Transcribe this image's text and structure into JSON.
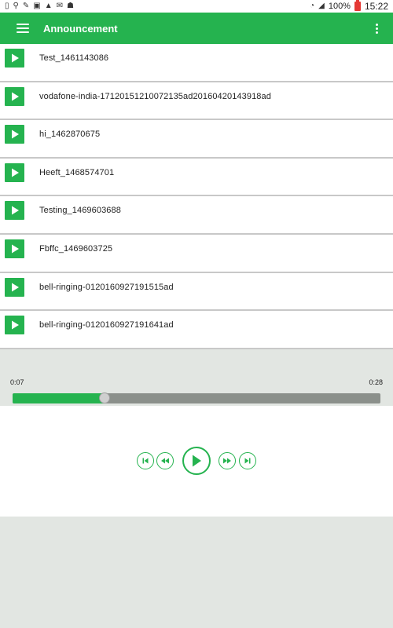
{
  "status_bar": {
    "battery": "100%",
    "time": "15:22"
  },
  "app_bar": {
    "title": "Announcement"
  },
  "tracks": [
    "Test_1461143086",
    "vodafone-india-17120151210072135ad20160420143918ad",
    "hi_1462870675",
    "Heeft_1468574701",
    "Testing_1469603688",
    "Fbffc_1469603725",
    "bell-ringing-0120160927191515ad",
    "bell-ringing-0120160927191641ad"
  ],
  "player": {
    "current_time": "0:07",
    "total_time": "0:28",
    "progress": 0.25
  },
  "colors": {
    "accent": "#25b34f",
    "progress_track": "#8b908b",
    "background": "#e2e6e2"
  },
  "icons": {
    "prev": "skip-previous-icon",
    "rewind": "rewind-icon",
    "play": "play-icon",
    "forward": "fast-forward-icon",
    "next": "skip-next-icon"
  }
}
